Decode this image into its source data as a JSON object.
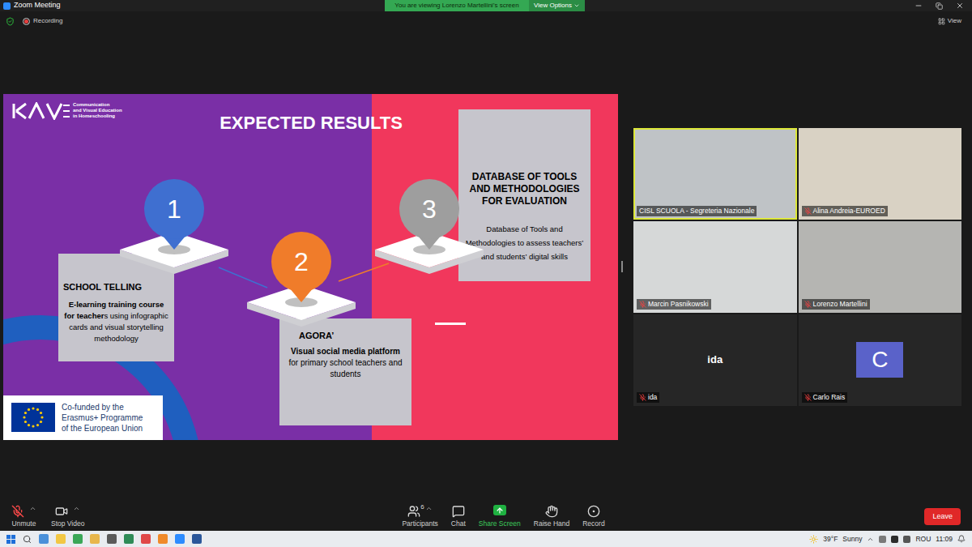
{
  "window": {
    "title": "Zoom Meeting"
  },
  "banner": {
    "text": "You are viewing Lorenzo Martellini's screen",
    "options": "View Options"
  },
  "recording": {
    "label": "Recording",
    "on": true
  },
  "view_button": {
    "label": "View"
  },
  "slide": {
    "logo": [
      "Communication",
      "and Visual Education",
      "in Homeschooling"
    ],
    "title": "EXPECTED RESULTS",
    "results": [
      {
        "number": "1",
        "color": "#3f6fd0",
        "heading": "SCHOOL TELLING",
        "description": [
          {
            "text": "E-learning training course for teacher",
            "bold": true
          },
          {
            "text": "s using infographic cards and visual storytelling methodology",
            "bold": false
          }
        ]
      },
      {
        "number": "2",
        "color": "#f07c2a",
        "heading": "AGORA’",
        "description": [
          {
            "text": "Visual social media platform",
            "bold": true
          },
          {
            "text": " for primary school teachers and students",
            "bold": false
          }
        ]
      },
      {
        "number": "3",
        "color": "#9e9e9e",
        "heading": "DATABASE OF TOOLS AND METHODOLOGIES FOR EVALUATION",
        "description": [
          {
            "text": "Database of Tools and Methodologies to assess teachers’ and students’ digital skills",
            "bold": false
          }
        ]
      }
    ],
    "funding": [
      "Co-funded by the",
      "Erasmus+ Programme",
      "of the European Union"
    ]
  },
  "participants": [
    {
      "name": "CISL SCUOLA - Segreteria Nazionale",
      "kind": "video",
      "muted": false,
      "speaking": true
    },
    {
      "name": "Alina Andreia-EUROED",
      "kind": "video",
      "muted": true,
      "speaking": false
    },
    {
      "name": "Marcin Pasnikowski",
      "kind": "video",
      "muted": true,
      "speaking": false
    },
    {
      "name": "Lorenzo Martellini",
      "kind": "video",
      "muted": true,
      "speaking": false
    },
    {
      "name": "ida",
      "kind": "name",
      "muted": true,
      "speaking": false
    },
    {
      "name": "Carlo Rais",
      "kind": "avatar",
      "avatar": "C",
      "muted": true,
      "speaking": false
    }
  ],
  "toolbar": {
    "left": [
      {
        "label": "Unmute",
        "has_menu": true,
        "muted": true
      },
      {
        "label": "Stop Video",
        "has_menu": true
      }
    ],
    "center": [
      {
        "label": "Participants",
        "count": "6",
        "has_menu": true
      },
      {
        "label": "Chat",
        "has_menu": false
      },
      {
        "label": "Share Screen",
        "has_menu": false
      },
      {
        "label": "Raise Hand",
        "has_menu": false
      },
      {
        "label": "Record",
        "has_menu": false
      }
    ],
    "leave": "Leave"
  },
  "taskbar": {
    "weather": {
      "temp": "39°F",
      "condition": "Sunny"
    },
    "language": "ROU",
    "time": "11:09"
  }
}
